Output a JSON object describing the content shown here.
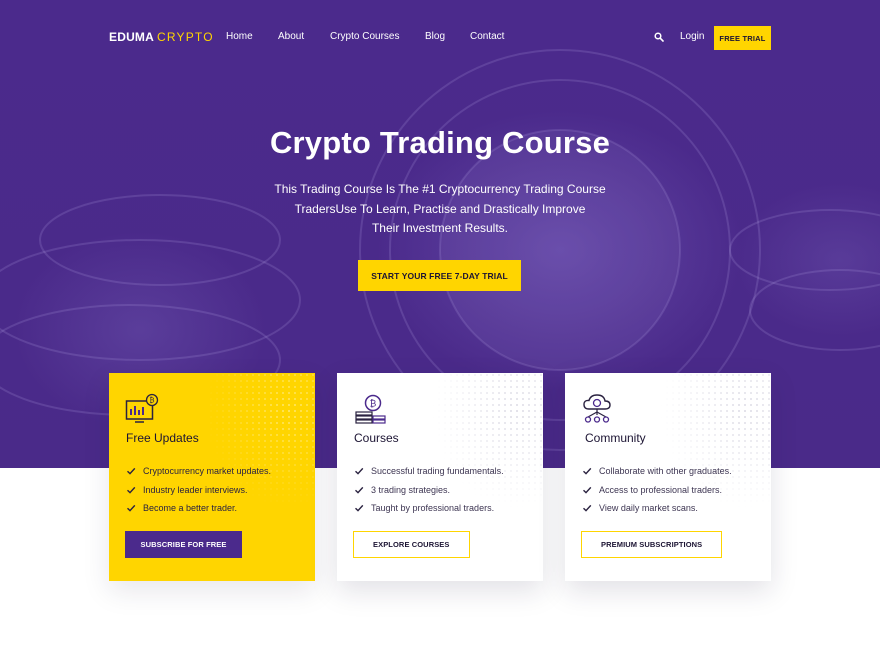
{
  "brand": {
    "logo_bold": "EDUMA",
    "logo_light": "CRYPTO"
  },
  "nav": {
    "items": [
      "Home",
      "About",
      "Crypto Courses",
      "Blog",
      "Contact"
    ],
    "login": "Login",
    "free_trial": "FREE TRIAL",
    "search_icon": "search-icon"
  },
  "hero": {
    "title": "Crypto Trading Course",
    "subtitle_lines": [
      "This Trading Course Is The #1 Cryptocurrency Trading Course",
      "TradersUse To Learn, Practise and Drastically Improve",
      "Their Investment Results."
    ],
    "cta": "START YOUR FREE 7-DAY TRIAL"
  },
  "cards": [
    {
      "title": "Free Updates",
      "icon": "chart-monitor-icon",
      "items": [
        "Cryptocurrency market updates.",
        "Industry leader interviews.",
        "Become a better trader."
      ],
      "button": "SUBSCRIBE FOR FREE"
    },
    {
      "title": "Courses",
      "icon": "coin-stack-icon",
      "items": [
        "Successful trading fundamentals.",
        "3 trading strategies.",
        "Taught by professional traders."
      ],
      "button": "EXPLORE COURSES"
    },
    {
      "title": "Community",
      "icon": "network-cloud-icon",
      "items": [
        "Collaborate with other graduates.",
        "Access to professional traders.",
        "View daily market scans."
      ],
      "button": "PREMIUM SUBSCRIPTIONS"
    }
  ],
  "colors": {
    "purple": "#4b2a8c",
    "yellow": "#ffd500",
    "dark_text": "#1c1433"
  }
}
